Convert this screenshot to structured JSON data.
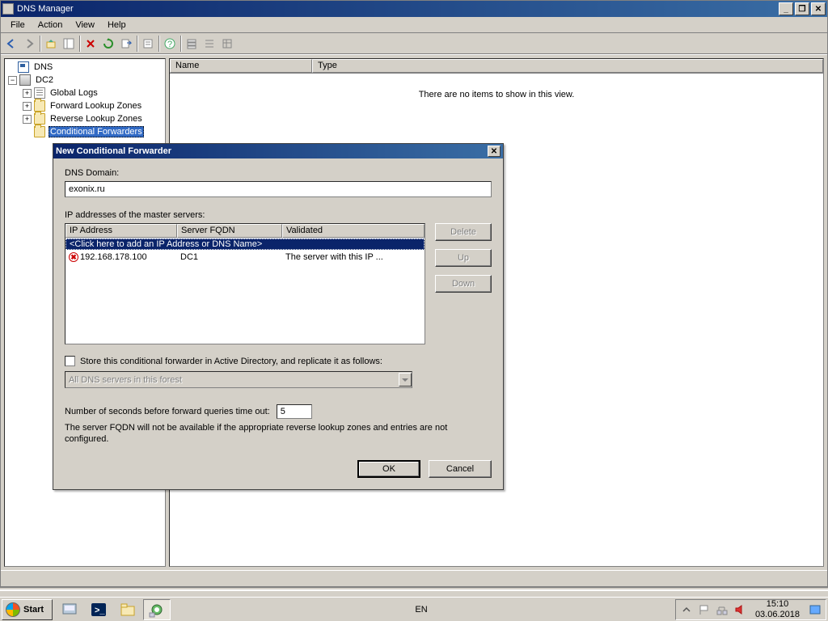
{
  "window": {
    "title": "DNS Manager",
    "menus": [
      "File",
      "Action",
      "View",
      "Help"
    ]
  },
  "tree": {
    "root": "DNS",
    "server": "DC2",
    "nodes": [
      {
        "label": "Global Logs",
        "icon": "log"
      },
      {
        "label": "Forward Lookup Zones",
        "icon": "folder"
      },
      {
        "label": "Reverse Lookup Zones",
        "icon": "folder"
      },
      {
        "label": "Conditional Forwarders",
        "icon": "folder",
        "selected": true
      }
    ]
  },
  "listview": {
    "columns": [
      "Name",
      "Type"
    ],
    "empty_message": "There are no items to show in this view."
  },
  "dialog": {
    "title": "New Conditional Forwarder",
    "domain_label": "DNS Domain:",
    "domain_value": "exonix.ru",
    "masters_label": "IP addresses of the master servers:",
    "masters_columns": [
      "IP Address",
      "Server FQDN",
      "Validated"
    ],
    "masters_add_placeholder": "<Click here to add an IP Address or DNS Name>",
    "masters_rows": [
      {
        "ip": "192.168.178.100",
        "fqdn": "DC1",
        "validated": "The server with this IP ...",
        "error": true
      }
    ],
    "btn_delete": "Delete",
    "btn_up": "Up",
    "btn_down": "Down",
    "store_ad_label": "Store this conditional forwarder in Active Directory, and replicate it as follows:",
    "replication_scope": "All DNS servers in this forest",
    "timeout_label": "Number of seconds before forward queries time out:",
    "timeout_value": "5",
    "fqdn_note": "The server FQDN will not be available if the appropriate reverse lookup zones and entries are not configured.",
    "btn_ok": "OK",
    "btn_cancel": "Cancel"
  },
  "taskbar": {
    "start": "Start",
    "lang": "EN",
    "time": "15:10",
    "date": "03.06.2018"
  }
}
